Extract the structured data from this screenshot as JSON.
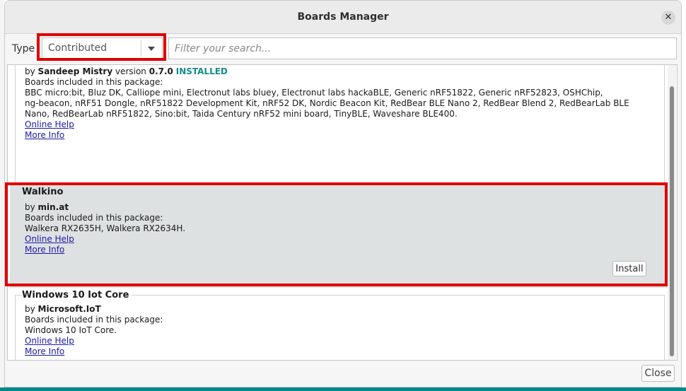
{
  "dialog": {
    "title": "Boards Manager",
    "close_glyph": "✕",
    "close_button": "Close"
  },
  "filter": {
    "type_label": "Type",
    "type_value": "Contributed",
    "search_placeholder": "Filter your search..."
  },
  "entries": [
    {
      "by_prefix": "by ",
      "author": "Sandeep Mistry",
      "version_label": " version ",
      "version": "0.7.0",
      "status": "INSTALLED",
      "boards_heading": "Boards included in this package:",
      "boards_lines": [
        "BBC micro:bit, Bluz DK, Calliope mini, Electronut labs bluey, Electronut labs hackaBLE, Generic nRF51822, Generic nRF52823, OSHChip,",
        "ng-beacon, nRF51 Dongle, nRF51822 Development Kit, nRF52 DK, Nordic Beacon Kit, RedBear BLE Nano 2, RedBear Blend 2, RedBearLab BLE",
        "Nano, RedBearLab nRF51822, Sino:bit, Taida Century nRF52 mini board, TinyBLE, Waveshare BLE400."
      ],
      "online_help": "Online Help",
      "more_info": "More Info"
    },
    {
      "name": "Walkino",
      "by_prefix": "by ",
      "author": "min.at",
      "boards_heading": "Boards included in this package:",
      "boards": "Walkera RX2635H, Walkera RX2634H.",
      "online_help": "Online Help",
      "more_info": "More Info",
      "install": "Install"
    },
    {
      "name": "Windows 10 Iot Core",
      "by_prefix": "by ",
      "author": "Microsoft.IoT",
      "boards_heading": "Boards included in this package:",
      "boards": "Windows 10 IoT Core.",
      "online_help": "Online Help",
      "more_info": "More Info"
    }
  ],
  "colors": {
    "highlight_red": "#e00000",
    "installed_teal": "#138b8b",
    "selected_row": "#dde1e2",
    "link_blue": "#1a1aa6"
  }
}
